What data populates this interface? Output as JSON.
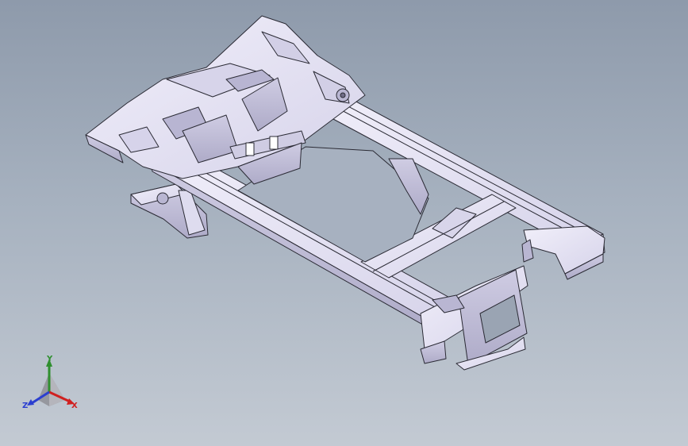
{
  "viewport": {
    "background_top": "#8e9aab",
    "background_bottom": "#c3cad3",
    "model": {
      "fill_color": "#e4e2f1",
      "shade_color": "#c9c6de",
      "edge_color": "#2b2b35"
    }
  },
  "triad": {
    "icon": "view-orientation-triad-icon",
    "x_label": "X",
    "y_label": "Y",
    "z_label": "Z",
    "x_color": "#d02020",
    "y_color": "#2f8f2f",
    "z_color": "#2b3fd0"
  }
}
